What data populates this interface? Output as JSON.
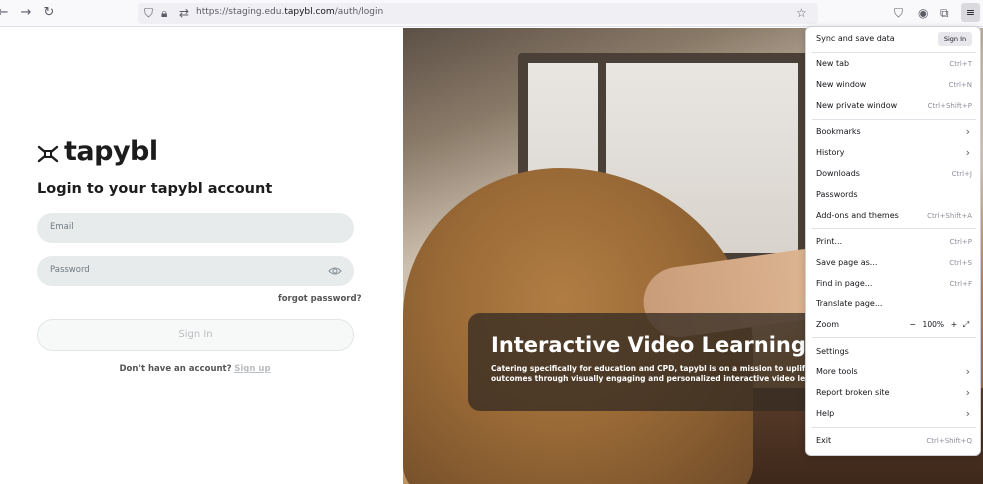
{
  "browser": {
    "url_prefix": "https://staging.edu.",
    "url_domain": "tapybl.com",
    "url_path": "/auth/login"
  },
  "login": {
    "brand": "tapybl",
    "heading": "Login to your tapybl account",
    "email_placeholder": "Email",
    "password_placeholder": "Password",
    "forgot": "forgot password?",
    "signin": "Sign In",
    "no_account": "Don't have an account?",
    "signup": "Sign up"
  },
  "hero": {
    "title": "Interactive Video Learning.",
    "line1": "Catering specifically for education and CPD, tapybl is on a mission to uplift",
    "line2": "outcomes through visually engaging and personalized interactive video lea"
  },
  "menu": {
    "sync": "Sync and save data",
    "sync_signin": "Sign In",
    "items": [
      {
        "label": "New tab",
        "shortcut": "Ctrl+T"
      },
      {
        "label": "New window",
        "shortcut": "Ctrl+N"
      },
      {
        "label": "New private window",
        "shortcut": "Ctrl+Shift+P"
      },
      {
        "label": "Bookmarks",
        "shortcut": ""
      },
      {
        "label": "History",
        "shortcut": ""
      },
      {
        "label": "Downloads",
        "shortcut": "Ctrl+J"
      },
      {
        "label": "Passwords",
        "shortcut": ""
      },
      {
        "label": "Add-ons and themes",
        "shortcut": "Ctrl+Shift+A"
      },
      {
        "label": "Print...",
        "shortcut": "Ctrl+P"
      },
      {
        "label": "Save page as...",
        "shortcut": "Ctrl+S"
      },
      {
        "label": "Find in page...",
        "shortcut": "Ctrl+F"
      },
      {
        "label": "Translate page...",
        "shortcut": ""
      },
      {
        "label": "Zoom",
        "shortcut": ""
      },
      {
        "label": "Settings",
        "shortcut": ""
      },
      {
        "label": "More tools",
        "shortcut": ""
      },
      {
        "label": "Report broken site",
        "shortcut": ""
      },
      {
        "label": "Help",
        "shortcut": ""
      },
      {
        "label": "Exit",
        "shortcut": "Ctrl+Shift+Q"
      }
    ],
    "zoom_value": "100%",
    "zoom_minus": "−",
    "zoom_plus": "+"
  }
}
